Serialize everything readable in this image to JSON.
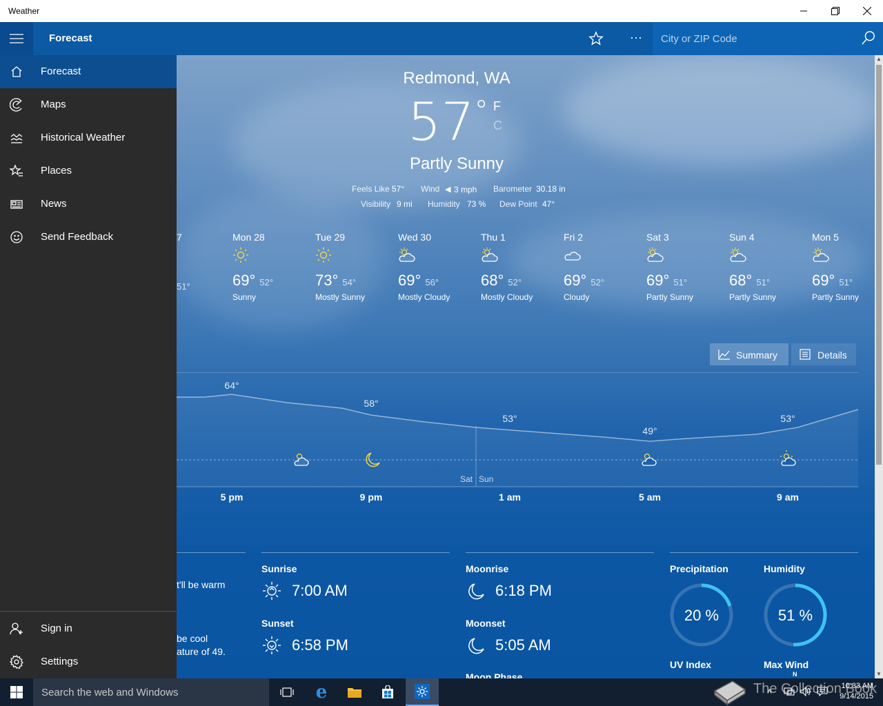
{
  "window": {
    "title": "Weather"
  },
  "appbar": {
    "title": "Forecast",
    "search_placeholder": "City or ZIP Code"
  },
  "nav": {
    "items": [
      {
        "label": "Forecast",
        "icon": "home-icon",
        "selected": true
      },
      {
        "label": "Maps",
        "icon": "radar-icon"
      },
      {
        "label": "Historical Weather",
        "icon": "chart-icon"
      },
      {
        "label": "Places",
        "icon": "star-list-icon"
      },
      {
        "label": "News",
        "icon": "news-icon"
      },
      {
        "label": "Send Feedback",
        "icon": "smiley-icon"
      }
    ],
    "bottom": [
      {
        "label": "Sign in",
        "icon": "person-icon"
      },
      {
        "label": "Settings",
        "icon": "gear-icon"
      }
    ]
  },
  "current": {
    "location": "Redmond, WA",
    "temp": "57",
    "degree": "°",
    "unit_f": "F",
    "unit_c": "C",
    "condition": "Partly Sunny",
    "details": {
      "feels_like_label": "Feels Like",
      "feels_like": "57°",
      "wind_label": "Wind",
      "wind": "3 mph",
      "barometer_label": "Barometer",
      "barometer": "30.18 in",
      "visibility_label": "Visibility",
      "visibility": "9 mi",
      "humidity_label": "Humidity",
      "humidity": "73 %",
      "dewpoint_label": "Dew Point",
      "dewpoint": "47°"
    }
  },
  "daily": [
    {
      "day": "7",
      "lo": "51°",
      "partial": true
    },
    {
      "day": "Mon 28",
      "hi": "69°",
      "lo": "52°",
      "cond": "Sunny",
      "icon": "sun-icon"
    },
    {
      "day": "Tue 29",
      "hi": "73°",
      "lo": "54°",
      "cond": "Mostly Sunny",
      "icon": "sun-icon"
    },
    {
      "day": "Wed 30",
      "hi": "69°",
      "lo": "56°",
      "cond": "Mostly Cloudy",
      "icon": "cloud-sun-icon"
    },
    {
      "day": "Thu 1",
      "hi": "68°",
      "lo": "52°",
      "cond": "Mostly Cloudy",
      "icon": "cloud-sun-icon"
    },
    {
      "day": "Fri 2",
      "hi": "69°",
      "lo": "52°",
      "cond": "Cloudy",
      "icon": "cloud-icon"
    },
    {
      "day": "Sat 3",
      "hi": "69°",
      "lo": "51°",
      "cond": "Partly Sunny",
      "icon": "cloud-sun-icon"
    },
    {
      "day": "Sun 4",
      "hi": "68°",
      "lo": "51°",
      "cond": "Partly Sunny",
      "icon": "cloud-sun-icon"
    },
    {
      "day": "Mon 5",
      "hi": "69°",
      "lo": "51°",
      "cond": "Partly Sunny",
      "icon": "cloud-sun-icon"
    }
  ],
  "toggle": {
    "summary": "Summary",
    "details": "Details"
  },
  "hourly": {
    "temps": [
      "64°",
      "58°",
      "53°",
      "49°",
      "53°"
    ],
    "times": [
      "5 pm",
      "9 pm",
      "1 am",
      "5 am",
      "9 am"
    ],
    "day_left": "Sat",
    "day_right": "Sun"
  },
  "summary_text": {
    "line1": "t'll be warm",
    "line2": "be cool",
    "line3": "ature of 49."
  },
  "sun": {
    "sunrise_label": "Sunrise",
    "sunrise": "7:00 AM",
    "sunset_label": "Sunset",
    "sunset": "6:58 PM"
  },
  "moon": {
    "moonrise_label": "Moonrise",
    "moonrise": "6:18 PM",
    "moonset_label": "Moonset",
    "moonset": "5:05 AM",
    "phase_label": "Moon Phase"
  },
  "stats": {
    "precip_label": "Precipitation",
    "precip": "20 %",
    "precip_fraction": 0.2,
    "humidity_label": "Humidity",
    "humidity": "51 %",
    "humidity_fraction": 0.51,
    "uv_label": "UV Index",
    "wind_label": "Max Wind",
    "wind_dir": "N"
  },
  "taskbar": {
    "search_placeholder": "Search the web and Windows",
    "time": "10:33 AM",
    "date": "9/14/2015"
  },
  "watermark": "The Collection Book"
}
